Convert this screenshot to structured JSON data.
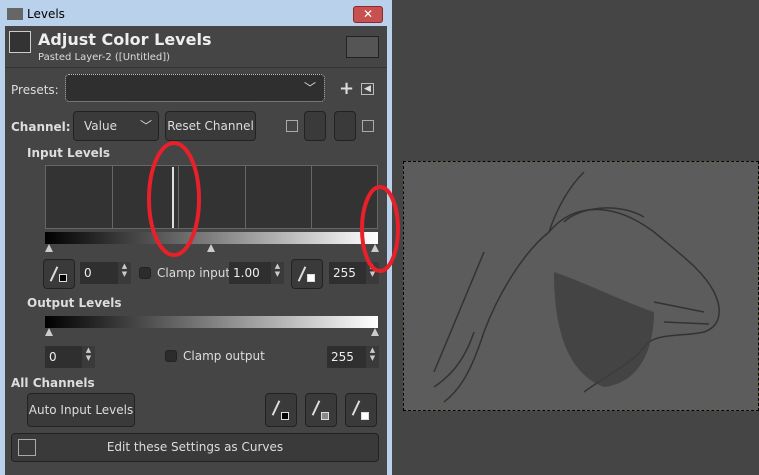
{
  "window": {
    "title": "Levels",
    "close": "✕"
  },
  "header": {
    "title": "Adjust Color Levels",
    "subtitle": "Pasted Layer-2 ([Untitled])"
  },
  "presets": {
    "label": "Presets:",
    "value": "",
    "add": "+",
    "menu": "◀"
  },
  "channel": {
    "label": "Channel:",
    "value": "Value",
    "reset": "Reset Channel"
  },
  "input_levels": {
    "label": "Input Levels",
    "low": "0",
    "gamma": "1.00",
    "high": "255",
    "clamp_label": "Clamp input",
    "clamp_checked": false,
    "histogram_peak_fraction": 0.5
  },
  "output_levels": {
    "label": "Output Levels",
    "low": "0",
    "high": "255",
    "clamp_label": "Clamp output",
    "clamp_checked": false
  },
  "all_channels": {
    "label": "All Channels",
    "auto": "Auto Input Levels",
    "curves": "Edit these Settings as Curves"
  },
  "colors": {
    "annotation": "#e8202a",
    "selection": "#ffff00"
  }
}
